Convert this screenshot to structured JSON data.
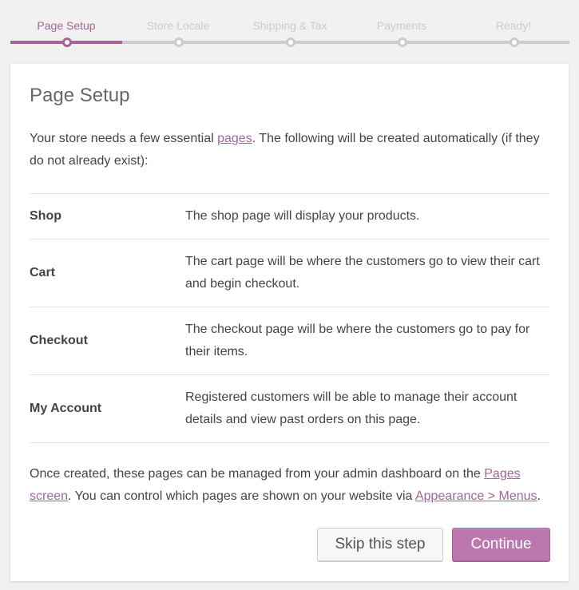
{
  "steps": [
    {
      "label": "Page Setup",
      "active": true
    },
    {
      "label": "Store Locale",
      "active": false
    },
    {
      "label": "Shipping & Tax",
      "active": false
    },
    {
      "label": "Payments",
      "active": false
    },
    {
      "label": "Ready!",
      "active": false
    }
  ],
  "colors": {
    "accent": "#a46497",
    "button": "#bb77ae",
    "inactive": "#cccccc"
  },
  "card": {
    "title": "Page Setup",
    "intro": {
      "before": "Your store needs a few essential ",
      "link": "pages",
      "after": ". The following will be created automatically (if they do not already exist):"
    },
    "pages": [
      {
        "name": "Shop",
        "description": "The shop page will display your products."
      },
      {
        "name": "Cart",
        "description": "The cart page will be where the customers go to view their cart and begin checkout."
      },
      {
        "name": "Checkout",
        "description": "The checkout page will be where the customers go to pay for their items."
      },
      {
        "name": "My Account",
        "description": "Registered customers will be able to manage their account details and view past orders on this page."
      }
    ],
    "outro": {
      "before": "Once created, these pages can be managed from your admin dashboard on the ",
      "link1": "Pages screen",
      "middle": ". You can control which pages are shown on your website via ",
      "link2": "Appearance > Menus",
      "after": "."
    },
    "skip_label": "Skip this step",
    "continue_label": "Continue"
  }
}
